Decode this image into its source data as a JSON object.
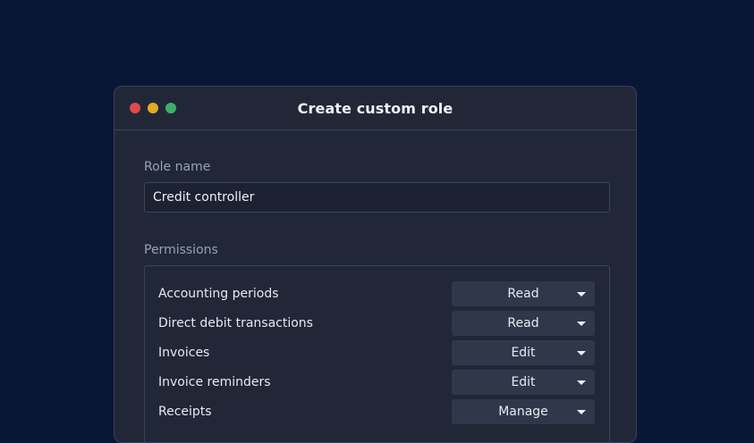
{
  "window": {
    "title": "Create custom role"
  },
  "role_name": {
    "label": "Role name",
    "value": "Credit controller"
  },
  "permissions": {
    "label": "Permissions",
    "items": [
      {
        "name": "Accounting periods",
        "level": "Read"
      },
      {
        "name": "Direct debit transactions",
        "level": "Read"
      },
      {
        "name": "Invoices",
        "level": "Edit"
      },
      {
        "name": "Invoice reminders",
        "level": "Edit"
      },
      {
        "name": "Receipts",
        "level": "Manage"
      }
    ]
  },
  "icons": {
    "close": "close-dot-icon",
    "minimize": "minimize-dot-icon",
    "maximize": "maximize-dot-icon",
    "dropdown": "caret-down-icon"
  },
  "colors": {
    "background": "#0a1636",
    "window": "#222738",
    "close": "#e0484f",
    "minimize": "#e3a92a",
    "maximize": "#3fae6a"
  }
}
